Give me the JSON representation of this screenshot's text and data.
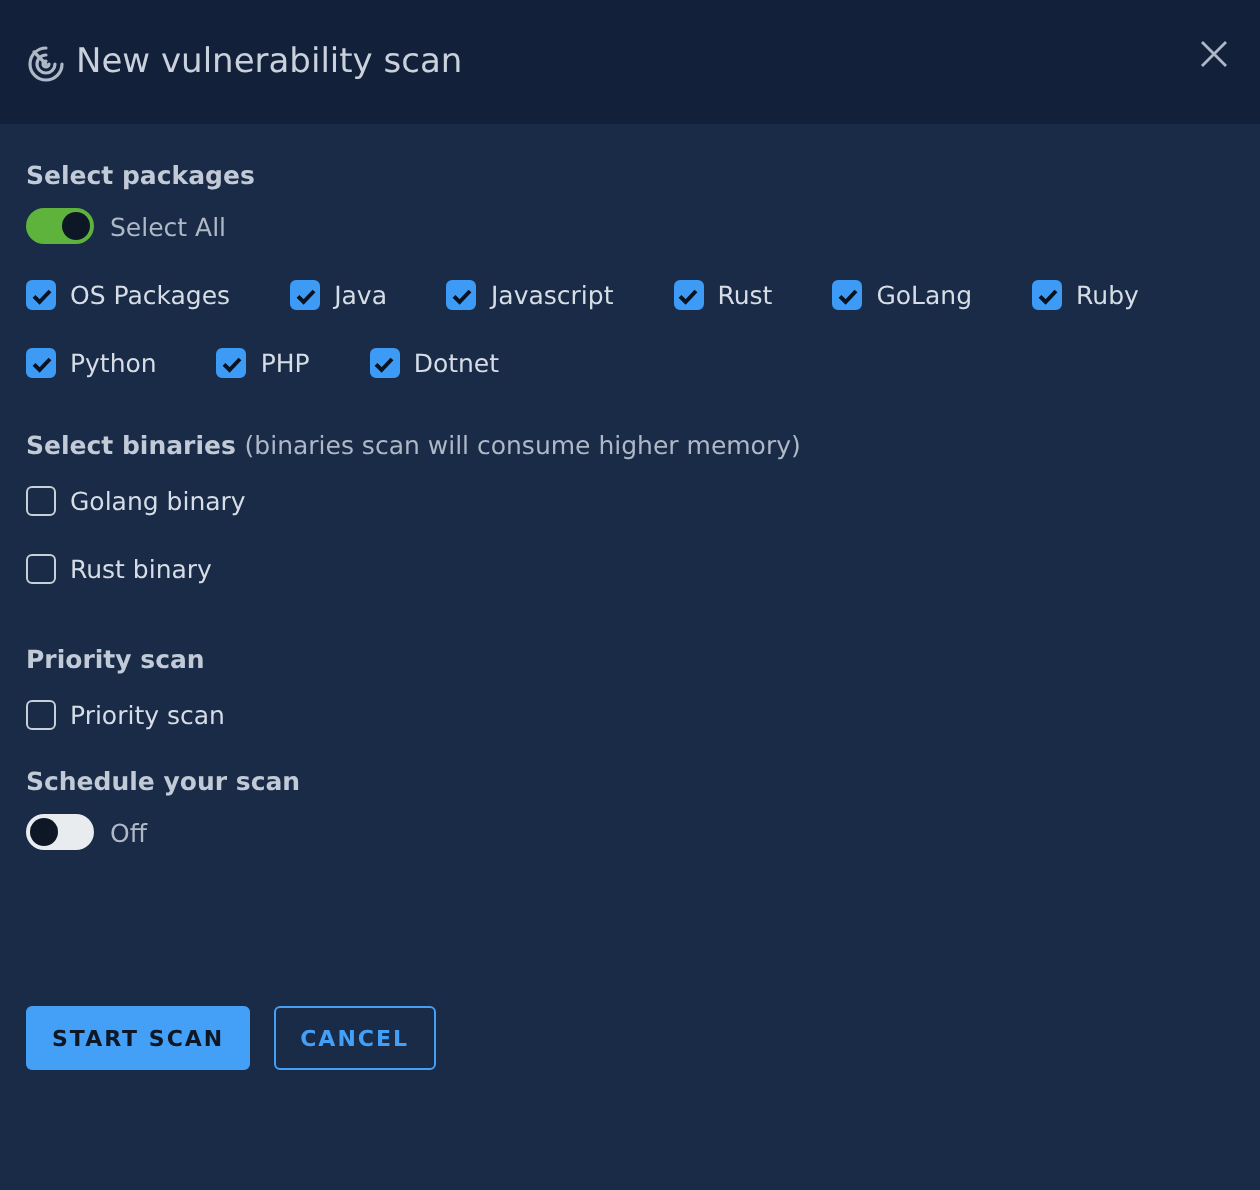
{
  "window": {
    "title": "New vulnerability scan"
  },
  "packages": {
    "heading": "Select packages",
    "select_all": {
      "label": "Select All",
      "on": true
    },
    "items": [
      {
        "label": "OS Packages",
        "checked": true
      },
      {
        "label": "Java",
        "checked": true
      },
      {
        "label": "Javascript",
        "checked": true
      },
      {
        "label": "Rust",
        "checked": true
      },
      {
        "label": "GoLang",
        "checked": true
      },
      {
        "label": "Ruby",
        "checked": true
      },
      {
        "label": "Python",
        "checked": true
      },
      {
        "label": "PHP",
        "checked": true
      },
      {
        "label": "Dotnet",
        "checked": true
      }
    ]
  },
  "binaries": {
    "heading": "Select binaries",
    "note": "(binaries scan will consume higher memory)",
    "items": [
      {
        "label": "Golang binary",
        "checked": false
      },
      {
        "label": "Rust binary",
        "checked": false
      }
    ]
  },
  "priority": {
    "heading": "Priority scan",
    "items": [
      {
        "label": "Priority scan",
        "checked": false
      }
    ]
  },
  "schedule": {
    "heading": "Schedule your scan",
    "toggle": {
      "label": "Off",
      "on": false
    }
  },
  "buttons": [
    {
      "label": "START SCAN",
      "kind": "primary"
    },
    {
      "label": "CANCEL",
      "kind": "outline"
    }
  ]
}
